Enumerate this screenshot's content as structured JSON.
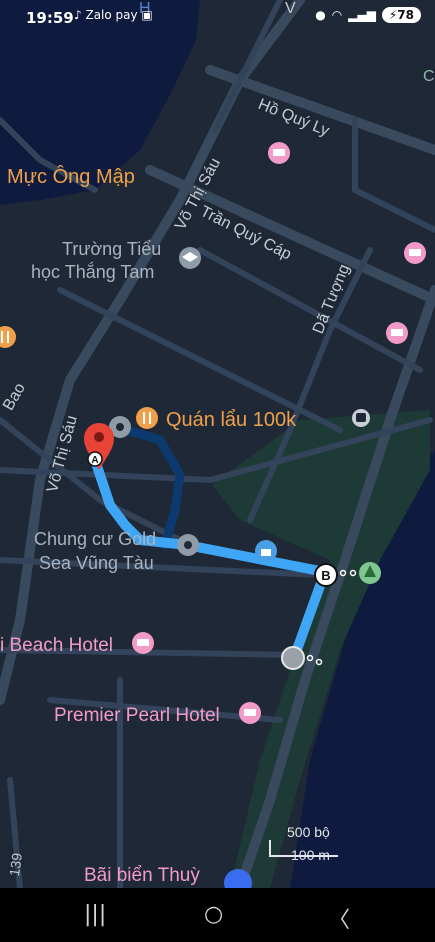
{
  "status_bar": {
    "time": "19:59",
    "app_icons": "♪ Zalo pay ▣",
    "battery": "78"
  },
  "places": {
    "muc_ong_map": "Mực Ông Mập",
    "school_line1": "Trường Tiểu",
    "school_line2": "học Thắng Tam",
    "quan_lau": "Quán lẩu 100k",
    "chung_cu_line1": "Chung cư Gold",
    "chung_cu_line2": "Sea Vũng Tàu",
    "beach_hotel": "i Beach Hotel",
    "premier_pearl": "Premier Pearl Hotel",
    "bai_bien": "Bãi biển Thuỳ"
  },
  "streets": {
    "ho_quy_ly": "Hồ Quý Ly",
    "tran_quy_cap": "Trần Quý Cáp",
    "vo_thi_sau_1": "Võ Thị Sáu",
    "vo_thi_sau_2": "Võ Thị Sáu",
    "da_tuong": "Dã Tượng",
    "bao": "Bao",
    "road_139": "139",
    "edge_v": "V",
    "edge_c": "C",
    "edge_h": "H"
  },
  "route": {
    "start_marker": "A",
    "end_marker": "B",
    "route_color": "#3ea6f5"
  },
  "scale": {
    "top": "500 bộ",
    "bottom": "100 m"
  },
  "nav": {
    "recents": "|||",
    "home": "○",
    "back": "〈"
  },
  "colors": {
    "map_bg": "#1f2836",
    "road": "#3a4a5e",
    "water": "#0f1b3e",
    "park": "#1d3a36"
  }
}
